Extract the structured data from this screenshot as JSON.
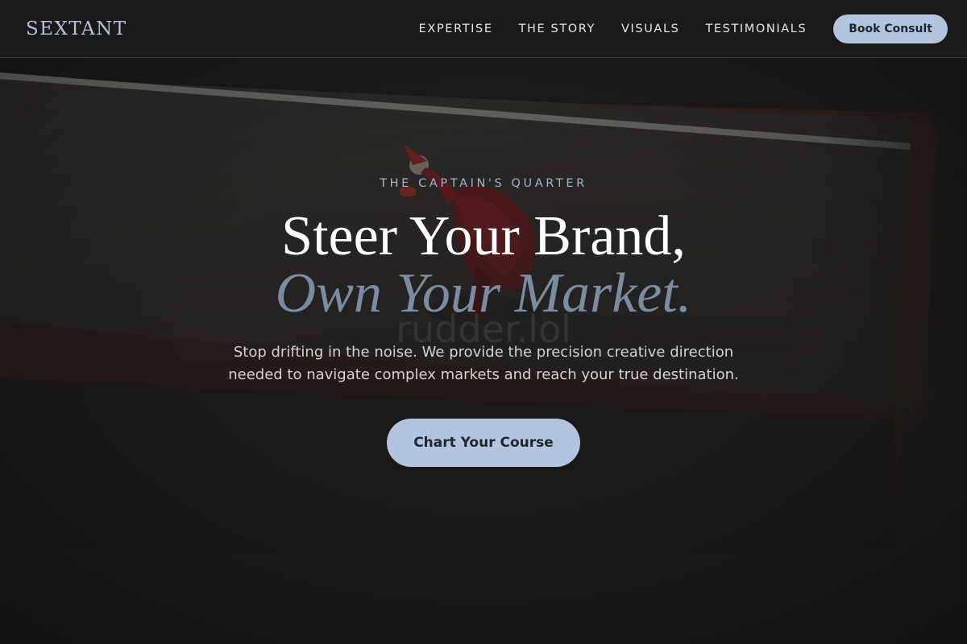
{
  "nav": {
    "brand": "SEXTANT",
    "links": [
      "EXPERTISE",
      "THE STORY",
      "VISUALS",
      "TESTIMONIALS"
    ],
    "cta_label": "Book Consult"
  },
  "hero": {
    "eyebrow": "THE CAPTAIN'S QUARTER",
    "headline_line1": "Steer Your Brand,",
    "headline_line2": "Own Your Market.",
    "watermark": "rudder.lol",
    "subtitle": "Stop drifting in the noise. We provide the precision creative direction needed to navigate complex markets and reach your true destination.",
    "cta_label": "Chart Your Course",
    "background_image": "person-in-red-jacket-skateboarding-on-ramp"
  },
  "colors": {
    "accent": "#b3c5de",
    "headline_primary": "#ffffff",
    "headline_secondary": "#7b8ba0",
    "page_background": "#1c1a19"
  }
}
